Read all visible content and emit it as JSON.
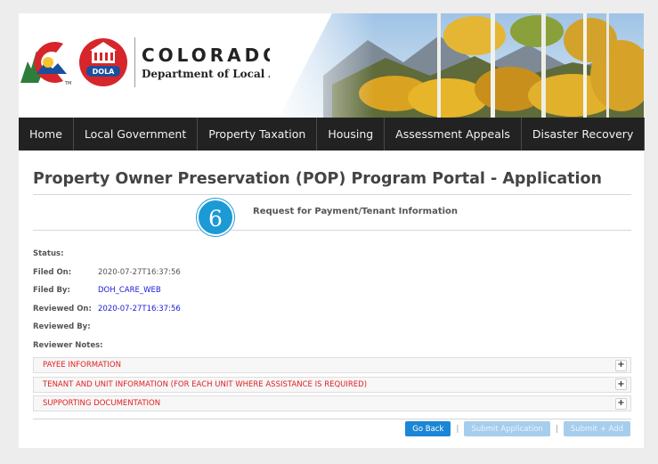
{
  "header": {
    "logo_title": "COLORADO",
    "logo_subtitle": "Department of Local Affairs",
    "dola_badge": "DOLA",
    "tm_mark": "TM"
  },
  "nav": {
    "items": [
      {
        "label": "Home"
      },
      {
        "label": "Local Government"
      },
      {
        "label": "Property Taxation"
      },
      {
        "label": "Housing"
      },
      {
        "label": "Assessment Appeals"
      },
      {
        "label": "Disaster Recovery"
      }
    ]
  },
  "main": {
    "title": "Property Owner Preservation (POP) Program Portal - Application",
    "step_number": "6",
    "step_label": "Request for Payment/Tenant Information"
  },
  "fields": [
    {
      "label": "Status:",
      "value": ""
    },
    {
      "label": "Filed On:",
      "value": "2020-07-27T16:37:56"
    },
    {
      "label": "Filed By:",
      "value": "DOH_CARE_WEB"
    },
    {
      "label": "Reviewed On:",
      "value": "2020-07-27T16:37:56"
    },
    {
      "label": "Reviewed By:",
      "value": ""
    },
    {
      "label": "Reviewer Notes:",
      "value": ""
    }
  ],
  "sections": [
    {
      "label": "PAYEE INFORMATION",
      "toggle": "+"
    },
    {
      "label": "TENANT AND UNIT INFORMATION (FOR EACH UNIT WHERE ASSISTANCE IS REQUIRED)",
      "toggle": "+"
    },
    {
      "label": "SUPPORTING DOCUMENTATION",
      "toggle": "+"
    }
  ],
  "actions": {
    "go_back": "Go Back",
    "separator": "|",
    "submit_application": "Submit Application",
    "submit_add": "Submit + Add"
  },
  "colors": {
    "nav_bg": "#222222",
    "step_circle": "#1c9ad6",
    "section_label": "#e02020",
    "link": "#1a1ad6",
    "primary_button": "#1c86d6",
    "disabled_button": "#a7cdec"
  }
}
